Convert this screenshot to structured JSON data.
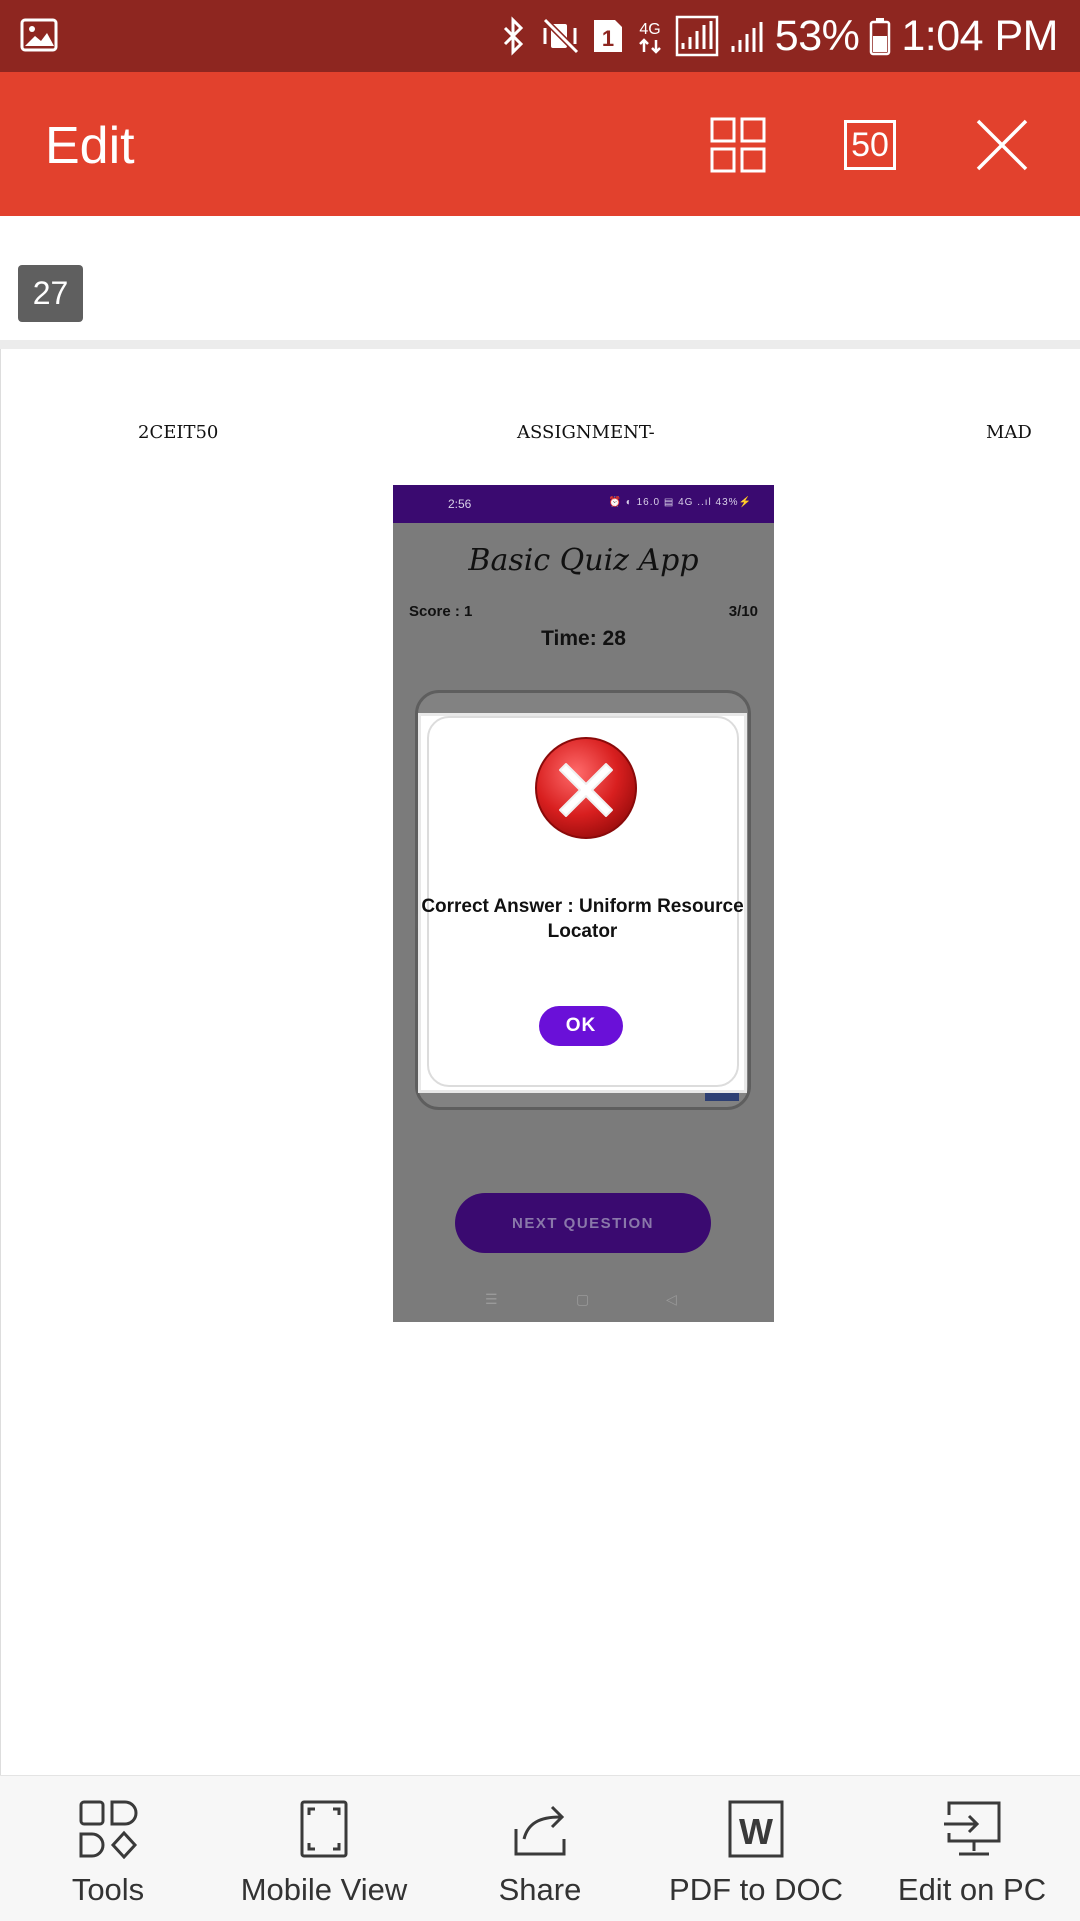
{
  "status_bar": {
    "battery": "53%",
    "time": "1:04 PM",
    "network": "4G",
    "sim_slot": "1"
  },
  "app_bar": {
    "title": "Edit",
    "page_total": "50"
  },
  "page": {
    "current_page": "27",
    "header_left": "2CEIT50",
    "header_center": "ASSIGNMENT-",
    "header_right": "MAD"
  },
  "phone": {
    "status_time": "2:56",
    "status_icons": "⏰ ◐ 16.0 ▤ 4G ..ıl 43%⚡",
    "app_title": "Basic Quiz App",
    "score": "Score : 1",
    "progress": "3/10",
    "timer": "Time: 28",
    "dialog_message": "Correct Answer : Uniform Resource Locator",
    "dialog_button": "OK",
    "next_button": "NEXT QUESTION"
  },
  "toolbar": {
    "items": [
      {
        "label": "Tools",
        "icon": "tools-icon"
      },
      {
        "label": "Mobile View",
        "icon": "mobile-view-icon"
      },
      {
        "label": "Share",
        "icon": "share-icon"
      },
      {
        "label": "PDF to DOC",
        "icon": "pdf-to-doc-icon"
      },
      {
        "label": "Edit on PC",
        "icon": "edit-on-pc-icon"
      }
    ]
  },
  "colors": {
    "status_bar": "#8e2620",
    "app_bar": "#e2412d",
    "dialog_ok": "#6a10d8",
    "phone_status": "#3a0a70",
    "error_icon": "#d81f1f"
  }
}
